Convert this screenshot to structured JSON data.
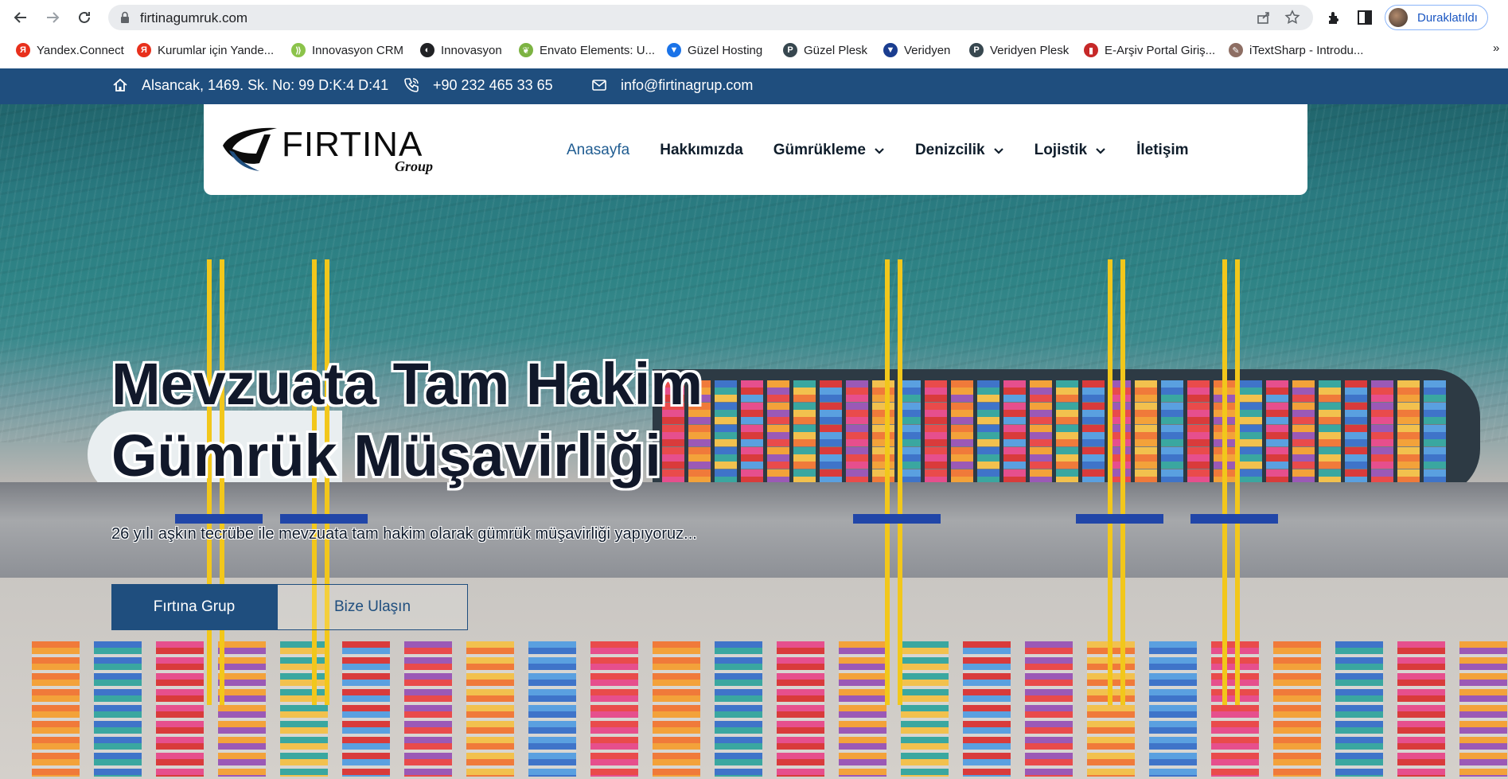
{
  "browser": {
    "url": "firtinagumruk.com",
    "profile_label": "Duraklatıldı",
    "bookmarks": [
      {
        "label": "Yandex.Connect",
        "color": "#e8301c",
        "glyph": "Я"
      },
      {
        "label": "Kurumlar için Yande...",
        "color": "#e8301c",
        "glyph": "Я"
      },
      {
        "label": "Innovasyon CRM",
        "color": "#8bc34a",
        "glyph": "⟫"
      },
      {
        "label": "Innovasyon",
        "color": "#202124",
        "glyph": "◐"
      },
      {
        "label": "Envato Elements: U...",
        "color": "#7cb342",
        "glyph": "❦"
      },
      {
        "label": "Güzel Hosting",
        "color": "#1a73e8",
        "glyph": "▼"
      },
      {
        "label": "Güzel Plesk",
        "color": "#37474f",
        "glyph": "P"
      },
      {
        "label": "Veridyen",
        "color": "#1a3d8f",
        "glyph": "▼"
      },
      {
        "label": "Veridyen Plesk",
        "color": "#37474f",
        "glyph": "P"
      },
      {
        "label": "E-Arşiv Portal Giriş...",
        "color": "#c62828",
        "glyph": "▮"
      },
      {
        "label": "iTextSharp - Introdu...",
        "color": "#8d6e63",
        "glyph": "✎"
      }
    ],
    "more_label": "»"
  },
  "infobar": {
    "address": "Alsancak, 1469. Sk. No: 99 D:K:4 D:41",
    "phone": "+90 232 465 33 65",
    "email": "info@firtinagrup.com"
  },
  "logo": {
    "main": "FIRTINA",
    "sub": "Group"
  },
  "nav": [
    {
      "label": "Anasayfa",
      "active": true,
      "dropdown": false
    },
    {
      "label": "Hakkımızda",
      "active": false,
      "dropdown": false
    },
    {
      "label": "Gümrükleme",
      "active": false,
      "dropdown": true
    },
    {
      "label": "Denizcilik",
      "active": false,
      "dropdown": true
    },
    {
      "label": "Lojistik",
      "active": false,
      "dropdown": true
    },
    {
      "label": "İletişim",
      "active": false,
      "dropdown": false
    }
  ],
  "hero": {
    "title_line1": "Mevzuata Tam Hakim",
    "title_line2": "Gümrük Müşavirliği",
    "subtitle": "26 yılı aşkın tecrübe ile mevzuata tam hakim olarak gümrük müşavirliği yapıyoruz...",
    "primary_button": "Fırtına Grup",
    "secondary_button": "Bize Ulaşın"
  },
  "colors": {
    "brand": "#1f4e7e",
    "active_nav": "#1f5c91"
  }
}
